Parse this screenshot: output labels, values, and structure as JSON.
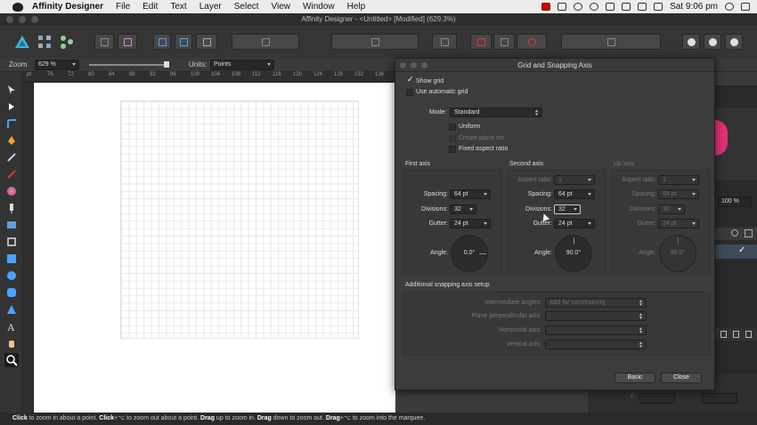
{
  "menubar": {
    "app_name": "Affinity Designer",
    "items": [
      "File",
      "Edit",
      "Text",
      "Layer",
      "Select",
      "View",
      "Window",
      "Help"
    ],
    "clock": "Sat 9:06 pm"
  },
  "window": {
    "title": "Affinity Designer - <Untitled> [Modified] (629.3%)"
  },
  "context": {
    "zoom_label": "Zoom",
    "zoom_value": "629 %",
    "units_label": "Units:",
    "units_value": "Points"
  },
  "ruler": {
    "ticks": [
      "pt",
      "76",
      "72",
      "80",
      "84",
      "88",
      "92",
      "96",
      "100",
      "104",
      "108",
      "112",
      "116",
      "120",
      "124",
      "128",
      "132",
      "136"
    ]
  },
  "right_panel": {
    "zoom_value": "100 %"
  },
  "dialog": {
    "title": "Grid and Snapping Axis",
    "show_grid_label": "Show grid",
    "use_auto_grid_label": "Use automatic grid",
    "mode_label": "Mode:",
    "mode_value": "Standard",
    "uniform_label": "Uniform",
    "create_plane_label": "Create plane set",
    "fixed_aspect_label": "Fixed aspect ratio",
    "first_axis": {
      "heading": "First axis",
      "spacing_label": "Spacing:",
      "spacing": "64 pt",
      "divisions_label": "Divisions:",
      "divisions": "32",
      "gutter_label": "Gutter:",
      "gutter": "24 pt",
      "angle_label": "Angle:",
      "angle": "0.0°"
    },
    "second_axis": {
      "heading": "Second axis",
      "aspect_label": "Aspect ratio:",
      "aspect": "1",
      "spacing_label": "Spacing:",
      "spacing": "64 pt",
      "divisions_label": "Divisions:",
      "divisions": "32",
      "gutter_label": "Gutter:",
      "gutter": "24 pt",
      "angle_label": "Angle:",
      "angle": "90.0°"
    },
    "up_axis": {
      "heading": "Up axis",
      "aspect_label": "Aspect ratio:",
      "aspect": "1",
      "spacing_label": "Spacing:",
      "spacing": "64 pt",
      "divisions_label": "Divisions:",
      "divisions": "32",
      "gutter_label": "Gutter:",
      "gutter": "24 pt",
      "angle_label": "Angle:",
      "angle": "90.0°"
    },
    "additional": {
      "heading": "Additional snapping axis setup",
      "intermediate_label": "Intermediate angles:",
      "intermediate_value": "Add for constraining",
      "plane_perp_label": "Plane perpendicular axis:",
      "horizontal_label": "Horizontal axis:",
      "vertical_label": "Vertical axis:"
    },
    "basic_button": "Basic",
    "close_button": "Close"
  },
  "status": {
    "parts": [
      {
        "t": "Click",
        "b": true
      },
      {
        "t": " to zoom in about a point. ",
        "b": false
      },
      {
        "t": "Click",
        "b": true
      },
      {
        "t": "+⌥ to zoom out about a point. ",
        "b": false
      },
      {
        "t": "Drag",
        "b": true
      },
      {
        "t": " up to zoom in. ",
        "b": false
      },
      {
        "t": "Drag",
        "b": true
      },
      {
        "t": " down to zoom out. ",
        "b": false
      },
      {
        "t": "Drag",
        "b": true
      },
      {
        "t": "+⌥ to zoom into the marquee.",
        "b": false
      }
    ]
  },
  "colors": {
    "accent": "#4aa3ff",
    "dialog_bg": "#3c3c3c",
    "canvas": "#ffffff"
  }
}
